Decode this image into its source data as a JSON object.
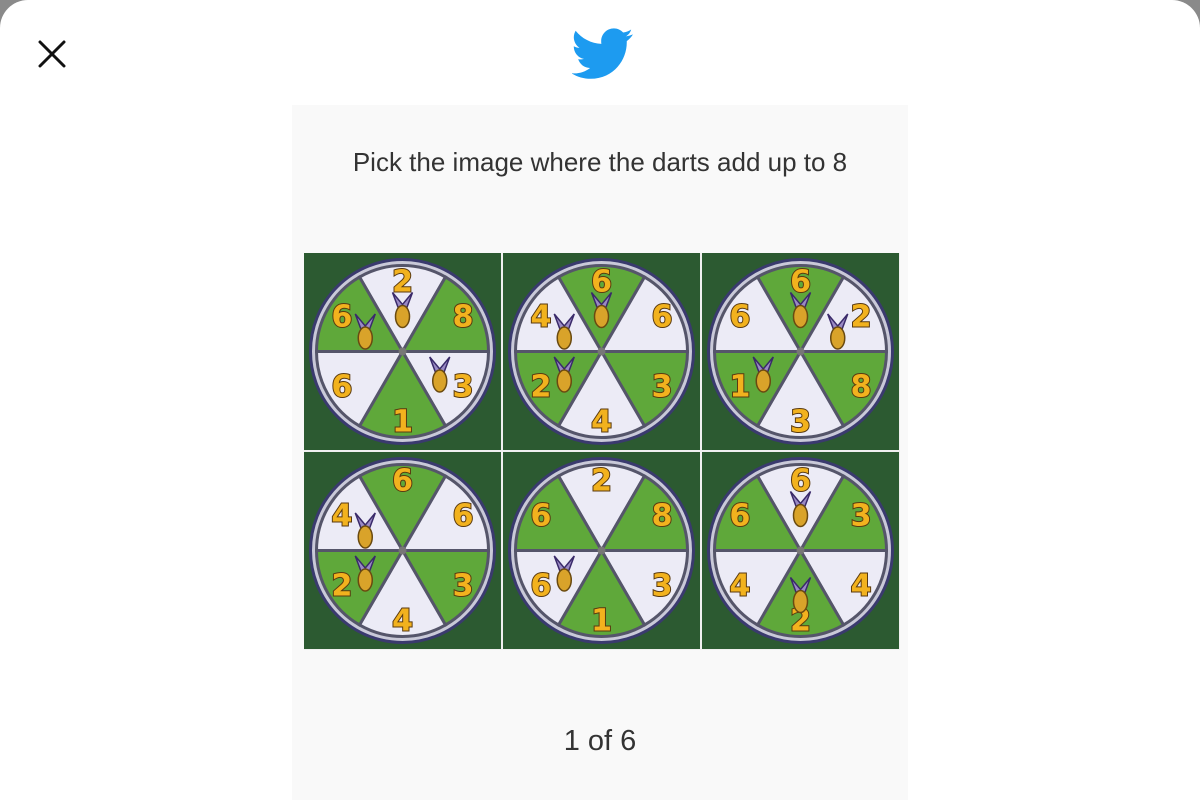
{
  "close": {
    "icon": "close-icon"
  },
  "logo": {
    "icon": "twitter-bird-icon",
    "color": "#1d9bf0"
  },
  "prompt": "Pick the image where the darts add up to 8",
  "counter": "1 of 6",
  "colors": {
    "white_slice": "#ecebf6",
    "green_slice": "#5fa83a",
    "rim": "#3a3a6e",
    "numeral": "#f2b21e",
    "dart": "#d9a32a",
    "background": "#2c5a31"
  },
  "tiles": [
    {
      "name": "tile-1",
      "slices": [
        {
          "n": "2",
          "fill": "white"
        },
        {
          "n": "8",
          "fill": "green"
        },
        {
          "n": "3",
          "fill": "white"
        },
        {
          "n": "1",
          "fill": "green"
        },
        {
          "n": "6",
          "fill": "white"
        },
        {
          "n": "6",
          "fill": "green"
        }
      ],
      "dart_slices": [
        0,
        2,
        5
      ]
    },
    {
      "name": "tile-2",
      "slices": [
        {
          "n": "6",
          "fill": "green"
        },
        {
          "n": "6",
          "fill": "white"
        },
        {
          "n": "3",
          "fill": "green"
        },
        {
          "n": "4",
          "fill": "white"
        },
        {
          "n": "2",
          "fill": "green"
        },
        {
          "n": "4",
          "fill": "white"
        }
      ],
      "dart_slices": [
        0,
        4,
        5
      ]
    },
    {
      "name": "tile-3",
      "slices": [
        {
          "n": "6",
          "fill": "green"
        },
        {
          "n": "2",
          "fill": "white"
        },
        {
          "n": "8",
          "fill": "green"
        },
        {
          "n": "3",
          "fill": "white"
        },
        {
          "n": "1",
          "fill": "green"
        },
        {
          "n": "6",
          "fill": "white"
        }
      ],
      "dart_slices": [
        0,
        1,
        4
      ]
    },
    {
      "name": "tile-4",
      "slices": [
        {
          "n": "6",
          "fill": "green"
        },
        {
          "n": "6",
          "fill": "white"
        },
        {
          "n": "3",
          "fill": "green"
        },
        {
          "n": "4",
          "fill": "white"
        },
        {
          "n": "2",
          "fill": "green"
        },
        {
          "n": "4",
          "fill": "white"
        }
      ],
      "dart_slices": [
        5,
        4
      ]
    },
    {
      "name": "tile-5",
      "slices": [
        {
          "n": "2",
          "fill": "white"
        },
        {
          "n": "8",
          "fill": "green"
        },
        {
          "n": "3",
          "fill": "white"
        },
        {
          "n": "1",
          "fill": "green"
        },
        {
          "n": "6",
          "fill": "white"
        },
        {
          "n": "6",
          "fill": "green"
        }
      ],
      "dart_slices": [
        4
      ]
    },
    {
      "name": "tile-6",
      "slices": [
        {
          "n": "6",
          "fill": "white"
        },
        {
          "n": "3",
          "fill": "green"
        },
        {
          "n": "4",
          "fill": "white"
        },
        {
          "n": "2",
          "fill": "green"
        },
        {
          "n": "4",
          "fill": "white"
        },
        {
          "n": "6",
          "fill": "green"
        }
      ],
      "dart_slices": [
        0,
        3
      ]
    }
  ]
}
